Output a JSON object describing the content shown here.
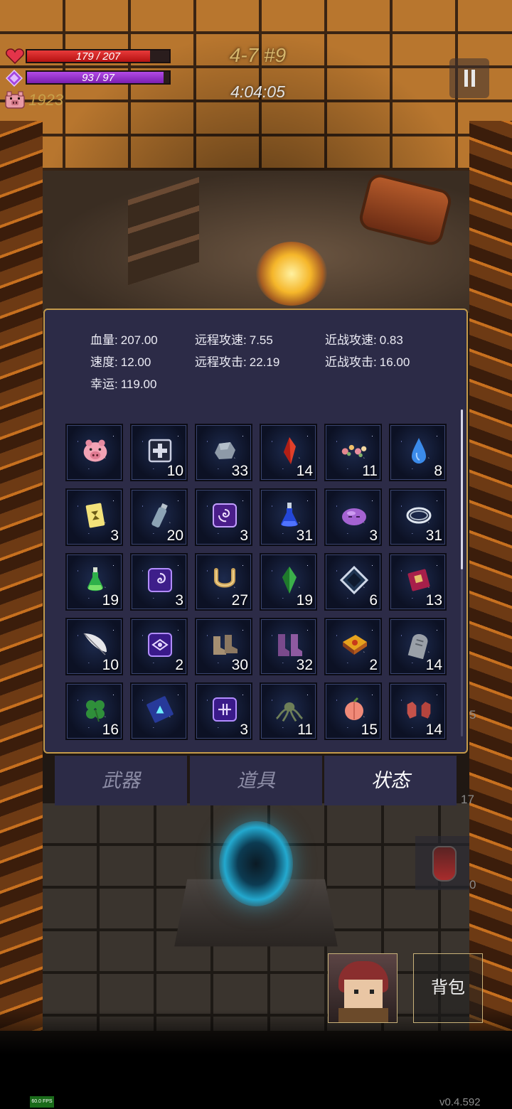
{
  "hud": {
    "hp_text": "179 / 207",
    "hp_fraction": 0.8647,
    "mp_text": "93 / 97",
    "mp_fraction": 0.9588,
    "coins": "1923",
    "level": "4-7 #9",
    "timer": "4:04:05",
    "icons": {
      "hp": "heart-icon",
      "mp": "gem-icon",
      "coins": "pig-icon",
      "pause": "pause-icon"
    }
  },
  "stats": {
    "hp_label": "血量:",
    "hp_value": "207.00",
    "speed_label": "速度:",
    "speed_value": "12.00",
    "luck_label": "幸运:",
    "luck_value": "119.00",
    "ranged_speed_label": "远程攻速:",
    "ranged_speed_value": "7.55",
    "ranged_attack_label": "远程攻击:",
    "ranged_attack_value": "22.19",
    "melee_speed_label": "近战攻速:",
    "melee_speed_value": "0.83",
    "melee_attack_label": "近战攻击:",
    "melee_attack_value": "16.00"
  },
  "items": [
    {
      "icon": "piggy-bank-icon",
      "count": ""
    },
    {
      "icon": "medkit-icon",
      "count": "10"
    },
    {
      "icon": "stone-icon",
      "count": "33"
    },
    {
      "icon": "red-crystal-icon",
      "count": "14"
    },
    {
      "icon": "flower-wreath-icon",
      "count": "11"
    },
    {
      "icon": "water-drop-icon",
      "count": "8"
    },
    {
      "icon": "yellow-card-icon",
      "count": "3"
    },
    {
      "icon": "glass-bottle-icon",
      "count": "20"
    },
    {
      "icon": "purple-spiral-rune-icon",
      "count": "3"
    },
    {
      "icon": "blue-potion-icon",
      "count": "31"
    },
    {
      "icon": "purple-slime-icon",
      "count": "3"
    },
    {
      "icon": "silver-rings-icon",
      "count": "31"
    },
    {
      "icon": "green-potion-icon",
      "count": "19"
    },
    {
      "icon": "purple-swirl-rune-icon",
      "count": "3"
    },
    {
      "icon": "horseshoe-icon",
      "count": "27"
    },
    {
      "icon": "green-crystal-icon",
      "count": "19"
    },
    {
      "icon": "diamond-frame-icon",
      "count": "6"
    },
    {
      "icon": "red-spellbook-icon",
      "count": "13"
    },
    {
      "icon": "white-feather-icon",
      "count": "10"
    },
    {
      "icon": "purple-eye-rune-icon",
      "count": "2"
    },
    {
      "icon": "leather-boots-icon",
      "count": "30"
    },
    {
      "icon": "purple-boots-icon",
      "count": "32"
    },
    {
      "icon": "gold-tome-icon",
      "count": "2"
    },
    {
      "icon": "tombstone-icon",
      "count": "14"
    },
    {
      "icon": "four-leaf-clover-icon",
      "count": "16"
    },
    {
      "icon": "blue-triangle-book-icon",
      "count": ""
    },
    {
      "icon": "purple-cross-rune-icon",
      "count": "3"
    },
    {
      "icon": "green-tentacle-icon",
      "count": "11"
    },
    {
      "icon": "peach-icon",
      "count": "15"
    },
    {
      "icon": "red-gloves-icon",
      "count": "14"
    }
  ],
  "tabs": {
    "weapons": "武器",
    "items": "道具",
    "status": "状态"
  },
  "side": {
    "num_a": "5",
    "num_b": "17",
    "num_c": "0"
  },
  "bag_label": "背包",
  "fps": "60.0 FPS",
  "version": "v0.4.592"
}
